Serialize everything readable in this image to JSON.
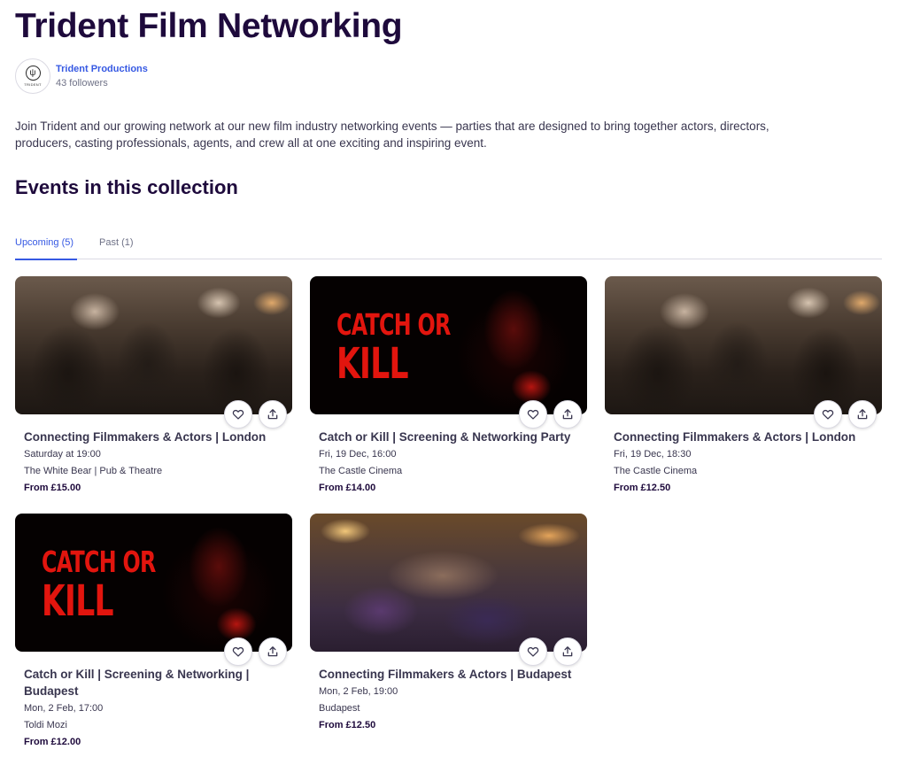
{
  "page": {
    "title": "Trident Film Networking",
    "description": "Join Trident and our growing network at our new film industry networking events — parties that are designed to bring together actors, directors, producers, casting professionals, agents, and crew all at one exciting and inspiring event."
  },
  "organizer": {
    "name": "Trident Productions",
    "followers": "43 followers",
    "logo_text": "TRIDENT"
  },
  "collection": {
    "title": "Events in this collection",
    "tabs": [
      {
        "label": "Upcoming (5)",
        "active": true
      },
      {
        "label": "Past (1)",
        "active": false
      }
    ]
  },
  "events": [
    {
      "title": "Connecting Filmmakers & Actors | London",
      "date": "Saturday at 19:00",
      "venue": "The White Bear | Pub & Theatre",
      "price": "From £15.00",
      "image": "crowd"
    },
    {
      "title": "Catch or Kill | Screening & Networking Party",
      "date": "Fri, 19 Dec, 16:00",
      "venue": "The Castle Cinema",
      "price": "From £14.00",
      "image": "catch-or-kill-poster",
      "image_text": [
        "CATCH OR",
        "KILL"
      ]
    },
    {
      "title": "Connecting Filmmakers & Actors | London",
      "date": "Fri, 19 Dec, 18:30",
      "venue": "The Castle Cinema",
      "price": "From £12.50",
      "image": "crowd"
    },
    {
      "title": "Catch or Kill | Screening & Networking | Budapest",
      "date": "Mon, 2 Feb, 17:00",
      "venue": "Toldi Mozi",
      "price": "From £12.00",
      "image": "catch-or-kill-poster",
      "image_text": [
        "CATCH OR",
        "KILL"
      ]
    },
    {
      "title": "Connecting Filmmakers & Actors | Budapest",
      "date": "Mon, 2 Feb, 19:00",
      "venue": "Budapest",
      "price": "From £12.50",
      "image": "party"
    }
  ],
  "colors": {
    "heading": "#1e0a3c",
    "link": "#3659e3",
    "muted": "#6f7287",
    "poster_red": "#e2150e"
  },
  "icons": {
    "like": "heart-icon",
    "share": "share-icon"
  }
}
